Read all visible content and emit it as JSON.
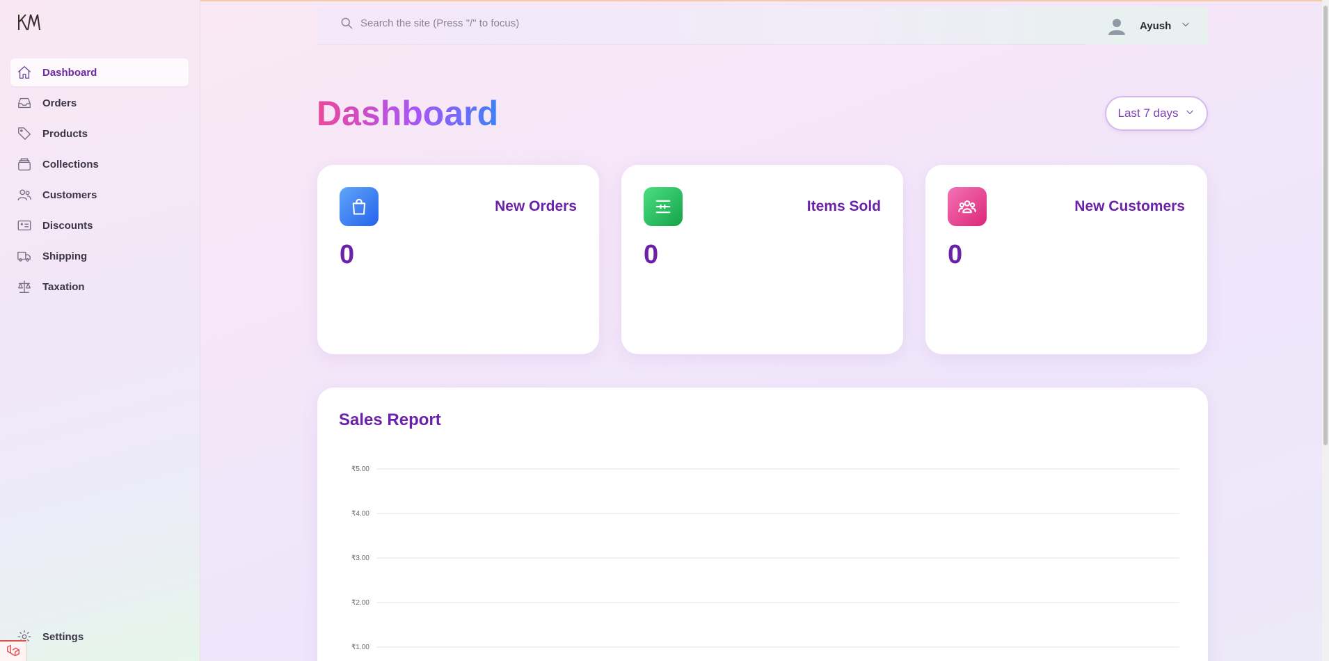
{
  "sidebar": {
    "items": [
      {
        "label": "Dashboard",
        "icon": "home-icon",
        "active": true
      },
      {
        "label": "Orders",
        "icon": "inbox-icon"
      },
      {
        "label": "Products",
        "icon": "tag-icon"
      },
      {
        "label": "Collections",
        "icon": "archive-icon"
      },
      {
        "label": "Customers",
        "icon": "users-icon"
      },
      {
        "label": "Discounts",
        "icon": "ticket-icon"
      },
      {
        "label": "Shipping",
        "icon": "truck-icon"
      },
      {
        "label": "Taxation",
        "icon": "scale-icon"
      }
    ],
    "settings_label": "Settings"
  },
  "header": {
    "search_placeholder": "Search the site (Press \"/\" to focus)",
    "user_name": "Ayush"
  },
  "main": {
    "title": "Dashboard",
    "date_range": "Last 7 days",
    "cards": [
      {
        "title": "New Orders",
        "value": "0",
        "icon": "shopping-bag-icon",
        "color": "#3b82f6"
      },
      {
        "title": "Items Sold",
        "value": "0",
        "icon": "sliders-icon",
        "color": "#22c55e"
      },
      {
        "title": "New Customers",
        "value": "0",
        "icon": "user-group-icon",
        "color": "#ec4899"
      }
    ]
  },
  "report": {
    "title": "Sales Report"
  },
  "chart_data": {
    "type": "line",
    "title": "Sales Report",
    "y_ticks": [
      "₹5.00",
      "₹4.00",
      "₹3.00",
      "₹2.00",
      "₹1.00"
    ],
    "ylim": [
      0,
      5
    ],
    "grid": true,
    "series": []
  },
  "colors": {
    "accent": "#6b21a8",
    "gradient_start": "#ec4899",
    "gradient_end": "#3b82f6"
  }
}
